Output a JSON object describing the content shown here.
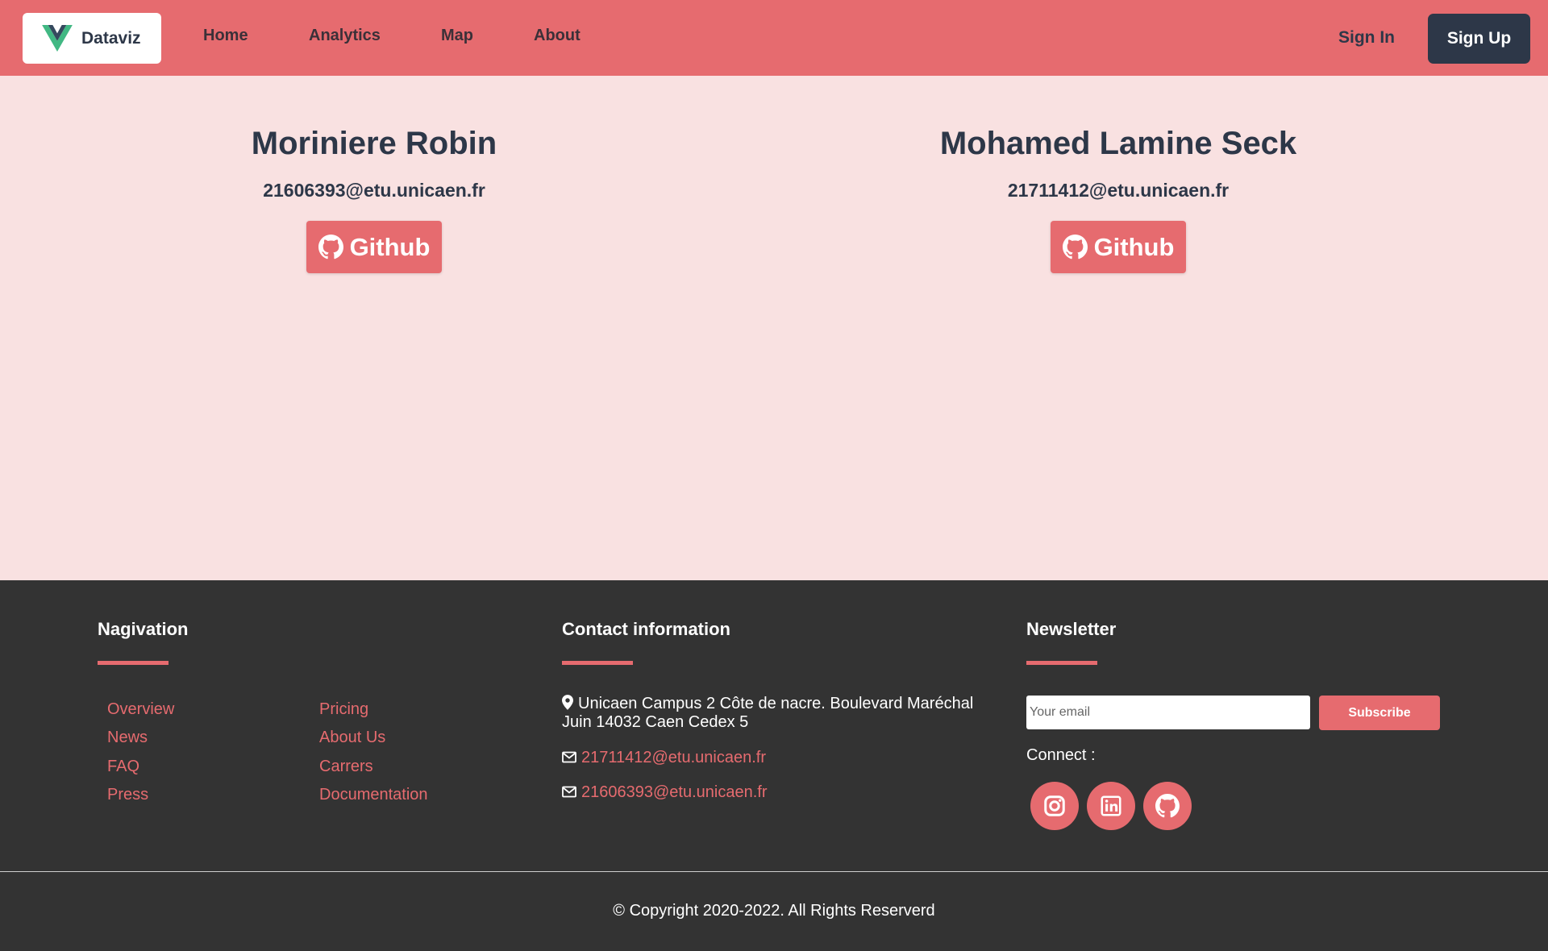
{
  "navbar": {
    "brand": "Dataviz",
    "links": [
      "Home",
      "Analytics",
      "Map",
      "About"
    ],
    "sign_in": "Sign In",
    "sign_up": "Sign Up",
    "colors": {
      "bar": "#e66b6f",
      "dark": "#2d3748"
    }
  },
  "team": [
    {
      "name": "Moriniere Robin",
      "email": "21606393@etu.unicaen.fr",
      "button": "Github"
    },
    {
      "name": "Mohamed Lamine Seck",
      "email": "21711412@etu.unicaen.fr",
      "button": "Github"
    }
  ],
  "footer": {
    "navigation": {
      "title": "Nagivation",
      "col1": [
        "Overview",
        "News",
        "FAQ",
        "Press"
      ],
      "col2": [
        "Pricing",
        "About Us",
        "Carrers",
        "Documentation"
      ]
    },
    "contact": {
      "title": "Contact information",
      "address": "Unicaen Campus 2 Côte de nacre. Boulevard Maréchal Juin 14032 Caen Cedex 5",
      "emails": [
        "21711412@etu.unicaen.fr",
        "21606393@etu.unicaen.fr"
      ]
    },
    "newsletter": {
      "title": "Newsletter",
      "placeholder": "Your email",
      "button": "Subscribe",
      "connect": "Connect :",
      "socials": [
        "instagram-icon",
        "linkedin-icon",
        "github-icon"
      ]
    },
    "copyright": "© Copyright 2020-2022. All Rights Reserverd",
    "colors": {
      "background": "#333333",
      "accent": "#e66b6f"
    }
  }
}
